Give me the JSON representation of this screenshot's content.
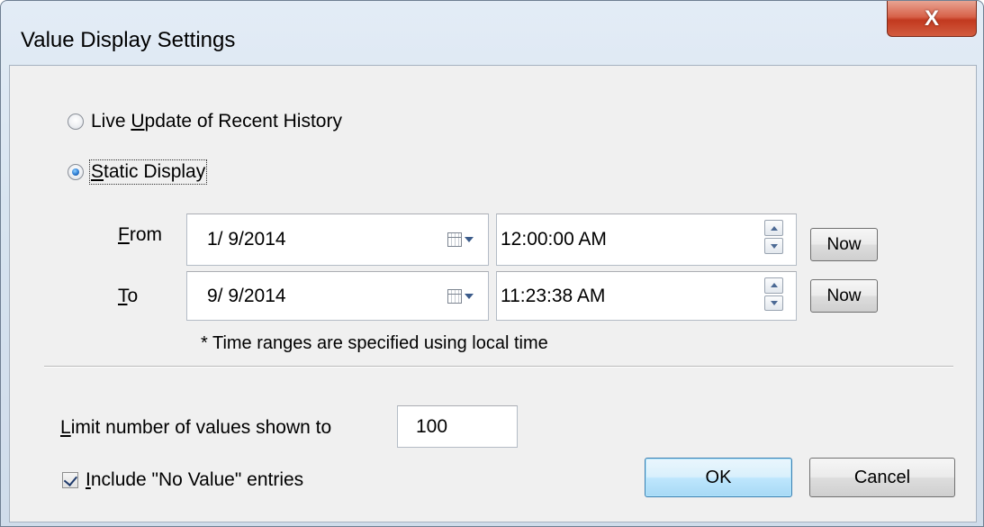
{
  "window": {
    "title": "Value Display Settings",
    "close_glyph": "X"
  },
  "mode": {
    "live_update": {
      "pre": "Live ",
      "mnemonic": "U",
      "post": "pdate of Recent History",
      "checked": false
    },
    "static_display": {
      "pre": "",
      "mnemonic": "S",
      "post": "tatic Display",
      "checked": true
    }
  },
  "range": {
    "from": {
      "label_mnemonic": "F",
      "label_rest": "rom",
      "date": "1/ 9/2014",
      "time": "12:00:00 AM",
      "now_label": "Now"
    },
    "to": {
      "label_mnemonic": "T",
      "label_rest": "o",
      "date": "9/ 9/2014",
      "time": "11:23:38 AM",
      "now_label": "Now"
    },
    "note": "* Time ranges are specified using local time"
  },
  "limit": {
    "label_mnemonic": "L",
    "label_rest": "imit number of values shown to",
    "value": "100"
  },
  "include_no_value": {
    "label_mnemonic": "I",
    "label_rest": "nclude \"No Value\" entries",
    "checked": true
  },
  "buttons": {
    "ok": "OK",
    "cancel": "Cancel"
  },
  "icons": {
    "close": "close-icon",
    "calendar": "calendar-icon",
    "spin_up": "spin-up-icon",
    "spin_down": "spin-down-icon",
    "check": "checkmark-icon"
  }
}
